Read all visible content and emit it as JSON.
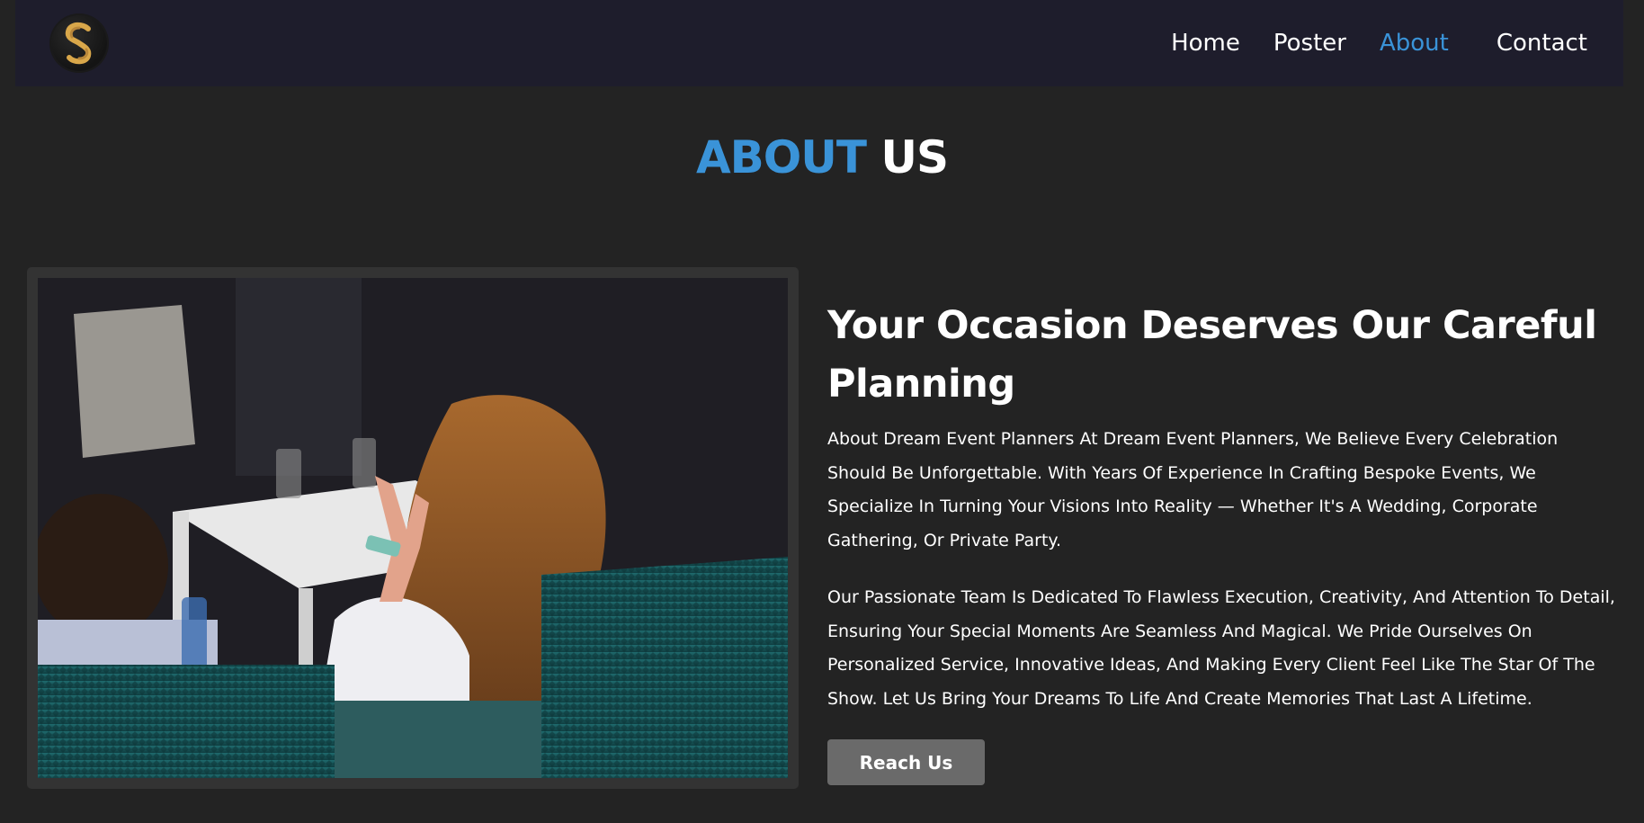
{
  "nav": {
    "logo_icon": "cs-monogram-logo",
    "links": [
      {
        "label": "Home",
        "active": false
      },
      {
        "label": "Poster",
        "active": false
      },
      {
        "label": "About",
        "active": true
      },
      {
        "label": "Contact",
        "active": false
      }
    ]
  },
  "about": {
    "title_accent": "ABOUT",
    "title_rest": "US",
    "heading": "Your Occasion Deserves Our Careful Planning",
    "paragraph_1": "About Dream Event Planners At Dream Event Planners, We Believe Every Celebration Should Be Unforgettable. With Years Of Experience In Crafting Bespoke Events, We Specialize In Turning Your Visions Into Reality — Whether It's A Wedding, Corporate Gathering, Or Private Party.",
    "paragraph_2": "Our Passionate Team Is Dedicated To Flawless Execution, Creativity, And Attention To Detail, Ensuring Your Special Moments Are Seamless And Magical. We Pride Ourselves On Personalized Service, Innovative Ideas, And Making Every Client Feel Like The Star Of The Show. Let Us Bring Your Dreams To Life And Create Memories That Last A Lifetime.",
    "button_label": "Reach Us",
    "image_subject": "event-audience-photo"
  },
  "colors": {
    "accent": "#3a93d8",
    "navbar_bg": "#1e1d2c",
    "page_bg": "#232323",
    "button_bg": "#6a6a6a"
  }
}
